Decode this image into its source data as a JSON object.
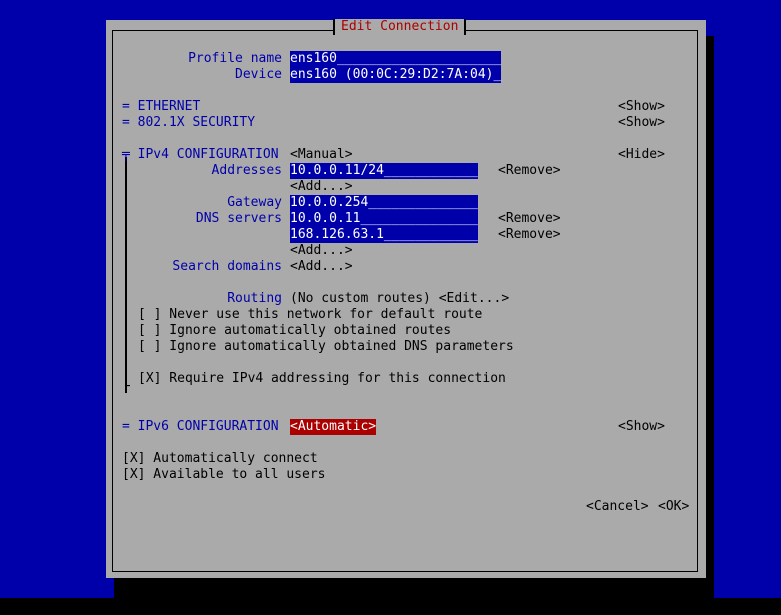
{
  "dialog_title": "Edit Connection",
  "profile": {
    "label": "Profile name",
    "value": "ens160_____________________"
  },
  "device": {
    "label": "Device",
    "value": "ens160 (00:0C:29:D2:7A:04)_"
  },
  "ethernet": {
    "label": "= ETHERNET",
    "toggle": "<Show>"
  },
  "security": {
    "label": "= 802.1X SECURITY",
    "toggle": "<Show>"
  },
  "ipv4": {
    "label": "╤ IPv4 CONFIGURATION",
    "mode": "<Manual>",
    "toggle": "<Hide>",
    "addresses_label": "Addresses",
    "address_1": "10.0.0.11/24____________",
    "remove_label": "<Remove>",
    "add_label": "<Add...>",
    "gateway_label": "Gateway",
    "gateway": "10.0.0.254______________",
    "dns_label": "DNS servers",
    "dns_1": "10.0.0.11_______________",
    "dns_2": "168.126.63.1____________",
    "search_label": "Search domains",
    "routing_label": "Routing",
    "routing_value": "(No custom routes) <Edit...>",
    "never_default": "[ ] Never use this network for default route",
    "ignore_routes": "[ ] Ignore automatically obtained routes",
    "ignore_dns": "[ ] Ignore automatically obtained DNS parameters",
    "require_ipv4": "[X] Require IPv4 addressing for this connection",
    "bottom": "└"
  },
  "ipv6": {
    "label": "= IPv6 CONFIGURATION",
    "mode": "<Automatic>",
    "toggle": "<Show>"
  },
  "auto_connect": "[X] Automatically connect",
  "all_users": "[X] Available to all users",
  "cancel": "<Cancel>",
  "ok": "<OK>",
  "colors": {
    "background": "#0000aa",
    "dialog": "#aaaaaa",
    "focus": "#aa0000",
    "label": "#0000aa"
  }
}
